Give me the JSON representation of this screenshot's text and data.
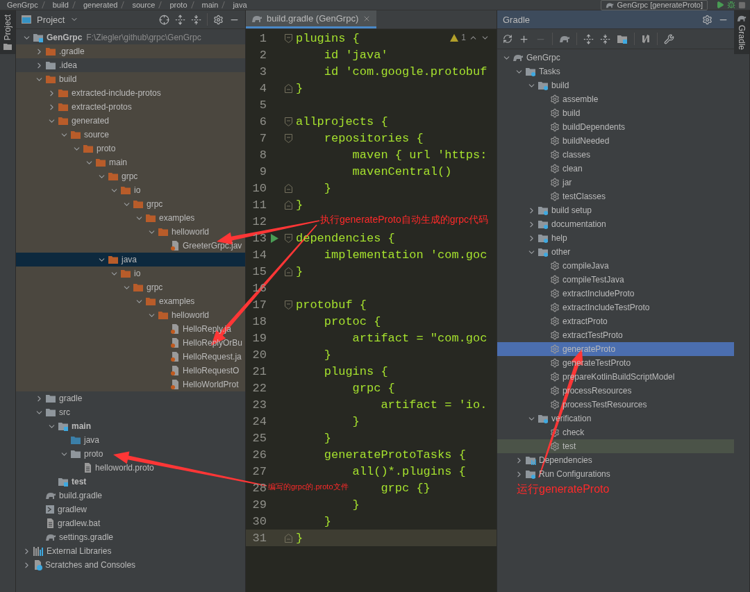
{
  "top_bar": {
    "breadcrumb": [
      "GenGrpc",
      "build",
      "generated",
      "source",
      "proto",
      "main",
      "java"
    ],
    "run_config": "GenGrpc [generateProto]"
  },
  "left_tabs": [
    {
      "label": "Project",
      "selected": true
    }
  ],
  "project": {
    "title": "Project",
    "tree": [
      {
        "label": "GenGrpc",
        "path": "F:\\Ziegler\\github\\grpc\\GenGrpc",
        "kind": "module",
        "expanded": true,
        "selected": false,
        "excluded": false,
        "children": [
          {
            "label": ".gradle",
            "kind": "folder",
            "expanded": false,
            "selected": false,
            "excluded": true
          },
          {
            "label": ".idea",
            "kind": "plain-folder",
            "expanded": false,
            "selected": false,
            "excluded": false
          },
          {
            "label": "build",
            "kind": "folder",
            "expanded": true,
            "selected": false,
            "excluded": true,
            "children": [
              {
                "label": "extracted-include-protos",
                "kind": "folder",
                "expanded": false,
                "selected": false,
                "excluded": true
              },
              {
                "label": "extracted-protos",
                "kind": "folder",
                "expanded": false,
                "selected": false,
                "excluded": true
              },
              {
                "label": "generated",
                "kind": "folder",
                "expanded": true,
                "selected": false,
                "excluded": true,
                "children": [
                  {
                    "label": "source",
                    "kind": "folder",
                    "expanded": true,
                    "selected": false,
                    "excluded": true,
                    "children": [
                      {
                        "label": "proto",
                        "kind": "folder",
                        "expanded": true,
                        "selected": false,
                        "excluded": true,
                        "children": [
                          {
                            "label": "main",
                            "kind": "folder",
                            "expanded": true,
                            "selected": false,
                            "excluded": true,
                            "children": [
                              {
                                "label": "grpc",
                                "kind": "folder",
                                "expanded": true,
                                "selected": false,
                                "excluded": true,
                                "children": [
                                  {
                                    "label": "io",
                                    "kind": "folder",
                                    "expanded": true,
                                    "selected": false,
                                    "excluded": true,
                                    "children": [
                                      {
                                        "label": "grpc",
                                        "kind": "folder",
                                        "expanded": true,
                                        "selected": false,
                                        "excluded": true,
                                        "children": [
                                          {
                                            "label": "examples",
                                            "kind": "folder",
                                            "expanded": true,
                                            "selected": false,
                                            "excluded": true,
                                            "children": [
                                              {
                                                "label": "helloworld",
                                                "kind": "folder",
                                                "expanded": true,
                                                "selected": false,
                                                "excluded": true,
                                                "children": [
                                                  {
                                                    "label": "GreeterGrpc.jav",
                                                    "kind": "java-file",
                                                    "selected": false,
                                                    "excluded": true
                                                  }
                                                ]
                                              }
                                            ]
                                          }
                                        ]
                                      }
                                    ]
                                  }
                                ]
                              },
                              {
                                "label": "java",
                                "kind": "folder",
                                "expanded": true,
                                "selected": true,
                                "excluded": true,
                                "children": [
                                  {
                                    "label": "io",
                                    "kind": "folder",
                                    "expanded": true,
                                    "selected": false,
                                    "excluded": true,
                                    "children": [
                                      {
                                        "label": "grpc",
                                        "kind": "folder",
                                        "expanded": true,
                                        "selected": false,
                                        "excluded": true,
                                        "children": [
                                          {
                                            "label": "examples",
                                            "kind": "folder",
                                            "expanded": true,
                                            "selected": false,
                                            "excluded": true,
                                            "children": [
                                              {
                                                "label": "helloworld",
                                                "kind": "folder",
                                                "expanded": true,
                                                "selected": false,
                                                "excluded": true,
                                                "children": [
                                                  {
                                                    "label": "HelloReply.ja",
                                                    "kind": "java-file",
                                                    "selected": false,
                                                    "excluded": true
                                                  },
                                                  {
                                                    "label": "HelloReplyOrBu",
                                                    "kind": "java-file",
                                                    "selected": false,
                                                    "excluded": true
                                                  },
                                                  {
                                                    "label": "HelloRequest.ja",
                                                    "kind": "java-file",
                                                    "selected": false,
                                                    "excluded": true
                                                  },
                                                  {
                                                    "label": "HelloRequestO",
                                                    "kind": "java-file",
                                                    "selected": false,
                                                    "excluded": true
                                                  },
                                                  {
                                                    "label": "HelloWorldProt",
                                                    "kind": "java-file",
                                                    "selected": false,
                                                    "excluded": true
                                                  }
                                                ]
                                              }
                                            ]
                                          }
                                        ]
                                      }
                                    ]
                                  }
                                ]
                              }
                            ]
                          }
                        ]
                      }
                    ]
                  }
                ]
              }
            ]
          },
          {
            "label": "gradle",
            "kind": "plain-folder",
            "expanded": false,
            "selected": false,
            "excluded": false
          },
          {
            "label": "src",
            "kind": "plain-folder",
            "expanded": true,
            "selected": false,
            "excluded": false,
            "children": [
              {
                "label": "main",
                "kind": "module",
                "expanded": true,
                "selected": false,
                "excluded": false,
                "children": [
                  {
                    "label": "java",
                    "kind": "source-folder",
                    "selected": false,
                    "excluded": false
                  },
                  {
                    "label": "proto",
                    "kind": "plain-folder",
                    "expanded": true,
                    "selected": false,
                    "excluded": false,
                    "children": [
                      {
                        "label": "helloworld.proto",
                        "kind": "text-file",
                        "selected": false,
                        "excluded": false
                      }
                    ]
                  }
                ]
              },
              {
                "label": "test",
                "kind": "module",
                "selected": false,
                "excluded": false
              }
            ]
          },
          {
            "label": "build.gradle",
            "kind": "gradle-file",
            "selected": false,
            "excluded": false
          },
          {
            "label": "gradlew",
            "kind": "script-file",
            "selected": false,
            "excluded": false
          },
          {
            "label": "gradlew.bat",
            "kind": "text-file",
            "selected": false,
            "excluded": false
          },
          {
            "label": "settings.gradle",
            "kind": "gradle-file",
            "selected": false,
            "excluded": false
          }
        ]
      },
      {
        "label": "External Libraries",
        "kind": "libraries",
        "expanded": false,
        "selected": false,
        "excluded": false
      },
      {
        "label": "Scratches and Consoles",
        "kind": "scratches",
        "expanded": false,
        "selected": false,
        "excluded": false
      }
    ]
  },
  "editor": {
    "tab": "build.gradle (GenGrpc)",
    "warnings": "1",
    "lines": [
      {
        "n": "1",
        "code": "plugins {",
        "kind": "fold-start",
        "run": false,
        "current": false
      },
      {
        "n": "2",
        "code": "    id 'java'",
        "kind": "plain",
        "run": false,
        "current": false
      },
      {
        "n": "3",
        "code": "    id 'com.google.protobuf",
        "kind": "plain",
        "run": false,
        "current": false
      },
      {
        "n": "4",
        "code": "}",
        "kind": "fold-end",
        "run": false,
        "current": false
      },
      {
        "n": "5",
        "kind": "plain",
        "run": false,
        "current": false
      },
      {
        "n": "6",
        "code": "allprojects {",
        "kind": "fold-start",
        "run": false,
        "current": false
      },
      {
        "n": "7",
        "code": "    repositories {",
        "kind": "fold-start",
        "run": false,
        "current": false
      },
      {
        "n": "8",
        "code": "        maven { url 'https:",
        "kind": "plain",
        "run": false,
        "current": false
      },
      {
        "n": "9",
        "code": "        mavenCentral()",
        "kind": "plain",
        "run": false,
        "current": false
      },
      {
        "n": "10",
        "code": "    }",
        "kind": "fold-end",
        "run": false,
        "current": false
      },
      {
        "n": "11",
        "code": "}",
        "kind": "fold-end",
        "run": false,
        "current": false
      },
      {
        "n": "12",
        "kind": "plain",
        "run": false,
        "current": false
      },
      {
        "n": "13",
        "code": "dependencies {",
        "kind": "fold-start",
        "run": true,
        "current": false
      },
      {
        "n": "14",
        "code": "    implementation 'com.goc",
        "kind": "plain",
        "run": false,
        "current": false
      },
      {
        "n": "15",
        "code": "}",
        "kind": "fold-end",
        "run": false,
        "current": false
      },
      {
        "n": "16",
        "kind": "plain",
        "run": false,
        "current": false
      },
      {
        "n": "17",
        "code": "protobuf {",
        "kind": "fold-start",
        "run": false,
        "current": false
      },
      {
        "n": "18",
        "code": "    protoc {",
        "kind": "plain",
        "run": false,
        "current": false
      },
      {
        "n": "19",
        "code": "        artifact = \"com.goc",
        "kind": "plain",
        "run": false,
        "current": false
      },
      {
        "n": "20",
        "code": "    }",
        "kind": "plain",
        "run": false,
        "current": false
      },
      {
        "n": "21",
        "code": "    plugins {",
        "kind": "plain",
        "run": false,
        "current": false
      },
      {
        "n": "22",
        "code": "        grpc {",
        "kind": "plain",
        "run": false,
        "current": false
      },
      {
        "n": "23",
        "code": "            artifact = 'io.",
        "kind": "plain",
        "run": false,
        "current": false
      },
      {
        "n": "24",
        "code": "        }",
        "kind": "plain",
        "run": false,
        "current": false
      },
      {
        "n": "25",
        "code": "    }",
        "kind": "plain",
        "run": false,
        "current": false
      },
      {
        "n": "26",
        "code": "    generateProtoTasks {",
        "kind": "plain",
        "run": false,
        "current": false
      },
      {
        "n": "27",
        "code": "        all()*.plugins {",
        "kind": "plain",
        "run": false,
        "current": false
      },
      {
        "n": "28",
        "code": "            grpc {}",
        "kind": "plain",
        "run": false,
        "current": false
      },
      {
        "n": "29",
        "code": "        }",
        "kind": "plain",
        "run": false,
        "current": false
      },
      {
        "n": "30",
        "code": "    }",
        "kind": "plain",
        "run": false,
        "current": false
      },
      {
        "n": "31",
        "code": "}",
        "kind": "fold-end",
        "run": false,
        "current": true
      }
    ]
  },
  "gradle": {
    "title": "Gradle",
    "tree": [
      {
        "label": "GenGrpc",
        "kind": "project",
        "expanded": true,
        "selected": false,
        "hovered": false,
        "children": [
          {
            "label": "Tasks",
            "kind": "group",
            "expanded": true,
            "selected": false,
            "hovered": false,
            "children": [
              {
                "label": "build",
                "kind": "group",
                "expanded": true,
                "selected": false,
                "hovered": false,
                "children": [
                  {
                    "label": "assemble",
                    "kind": "task",
                    "selected": false,
                    "hovered": false
                  },
                  {
                    "label": "build",
                    "kind": "task",
                    "selected": false,
                    "hovered": false
                  },
                  {
                    "label": "buildDependents",
                    "kind": "task",
                    "selected": false,
                    "hovered": false
                  },
                  {
                    "label": "buildNeeded",
                    "kind": "task",
                    "selected": false,
                    "hovered": false
                  },
                  {
                    "label": "classes",
                    "kind": "task",
                    "selected": false,
                    "hovered": false
                  },
                  {
                    "label": "clean",
                    "kind": "task",
                    "selected": false,
                    "hovered": false
                  },
                  {
                    "label": "jar",
                    "kind": "task",
                    "selected": false,
                    "hovered": false
                  },
                  {
                    "label": "testClasses",
                    "kind": "task",
                    "selected": false,
                    "hovered": false
                  }
                ]
              },
              {
                "label": "build setup",
                "kind": "group",
                "expanded": false,
                "selected": false,
                "hovered": false
              },
              {
                "label": "documentation",
                "kind": "group",
                "expanded": false,
                "selected": false,
                "hovered": false
              },
              {
                "label": "help",
                "kind": "group",
                "expanded": false,
                "selected": false,
                "hovered": false
              },
              {
                "label": "other",
                "kind": "group",
                "expanded": true,
                "selected": false,
                "hovered": false,
                "children": [
                  {
                    "label": "compileJava",
                    "kind": "task",
                    "selected": false,
                    "hovered": false
                  },
                  {
                    "label": "compileTestJava",
                    "kind": "task",
                    "selected": false,
                    "hovered": false
                  },
                  {
                    "label": "extractIncludeProto",
                    "kind": "task",
                    "selected": false,
                    "hovered": false
                  },
                  {
                    "label": "extractIncludeTestProto",
                    "kind": "task",
                    "selected": false,
                    "hovered": false
                  },
                  {
                    "label": "extractProto",
                    "kind": "task",
                    "selected": false,
                    "hovered": false
                  },
                  {
                    "label": "extractTestProto",
                    "kind": "task",
                    "selected": false,
                    "hovered": false
                  },
                  {
                    "label": "generateProto",
                    "kind": "task",
                    "selected": true,
                    "hovered": false
                  },
                  {
                    "label": "generateTestProto",
                    "kind": "task",
                    "selected": false,
                    "hovered": false
                  },
                  {
                    "label": "prepareKotlinBuildScriptModel",
                    "kind": "task",
                    "selected": false,
                    "hovered": false
                  },
                  {
                    "label": "processResources",
                    "kind": "task",
                    "selected": false,
                    "hovered": false
                  },
                  {
                    "label": "processTestResources",
                    "kind": "task",
                    "selected": false,
                    "hovered": false
                  }
                ]
              },
              {
                "label": "verification",
                "kind": "group",
                "expanded": true,
                "selected": false,
                "hovered": false,
                "children": [
                  {
                    "label": "check",
                    "kind": "task",
                    "selected": false,
                    "hovered": false
                  },
                  {
                    "label": "test",
                    "kind": "task",
                    "selected": false,
                    "hovered": true
                  }
                ]
              }
            ]
          },
          {
            "label": "Dependencies",
            "kind": "dependencies",
            "expanded": false,
            "selected": false,
            "hovered": false
          },
          {
            "label": "Run Configurations",
            "kind": "group",
            "expanded": false,
            "selected": false,
            "hovered": false
          }
        ]
      }
    ]
  },
  "right_tabs": [
    {
      "label": "Gradle",
      "selected": true
    }
  ],
  "annotations": [
    {
      "text": "执行generateProto自动生成的grpc代码"
    },
    {
      "text": "编写的grpc的.proto文件"
    },
    {
      "text": "运行generateProto"
    }
  ]
}
